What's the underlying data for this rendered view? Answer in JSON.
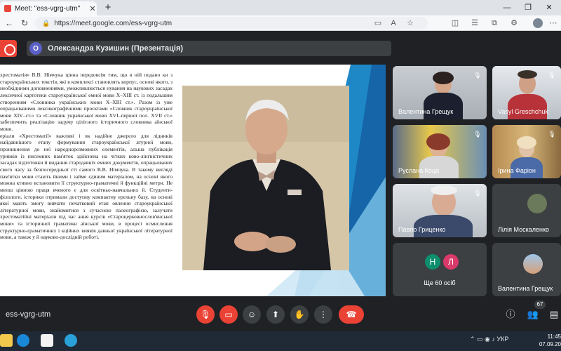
{
  "browser": {
    "tab_title": "Meet: \"ess-vgrg-utm\"",
    "url": "https://meet.google.com/ess-vgrg-utm"
  },
  "meeting": {
    "presenter_initial": "O",
    "presenter_label": "Олександра Кузишин (Презентація)",
    "meeting_code": "ess-vgrg-utm",
    "participant_count": "67"
  },
  "slide": {
    "paragraphs": [
      "хрестоматія» В.В. Німчука цінна передовсім тим, що в ній подано ки з староукраїнських текстів, які в комплексі становлять корпус, основі якого, з необхідними доповненнями, уможливлюється нування на наукових засадах лексичної картотеки староукраїнської емної мови X–XIII ст. із подальшим створенням «Словника українських мови X–XIII ст.». Разом із уже опрацьованими лексикографічними проєктами «Словник староукраїнської мови XIV–ст.» та «Словник української мови XVI–першої пол. XVII ст.» забезпечить реалізацію задуму цілісного історичного словника аїнської мови.",
      "еріали «Хрестоматії» важливі і як надійне джерело для лідників найдавнішого етапу формування староукраїнської атурної мови, проникнення до неї народнорозмовних елементів, альша публікація уривків із писемних пам'яток здійснена на чітких ково-лінгвістичних засадах підготовки й видання стародавніх емних документів, опрацьованих свого часу за безпосередньої сті самого В.В. Німчука. В такому вигляді пам'ятки мови стають йними і займе єдиним матеріалом, на основі якого можна ктивно встановити її структурно-граматичні й функційні метри. Не менш цінною праця вченого є для освітньо-навчальних й. Студенти-філологи, історики отримали доступну компактну ерельну базу, на основі якої мають змогу вивчати початковий етап овлення староукраїнської літературної мови, знайомитися з сучасною палеографією, залучати хрестоматійні матеріали під час ання курсів «Староцерковнослов'янської мови» та історичної граматики аїнської мови, в процесі осмислення структурно-граматичних і кційних виявів давньої української літературної мови, а також у й науково-дослідній роботі."
    ]
  },
  "participants": [
    {
      "name": "Валентина Грещук",
      "muted": true
    },
    {
      "name": "Vasyl Greschchuk",
      "muted": true
    },
    {
      "name": "Руслана Коца",
      "muted": true
    },
    {
      "name": "Ірина Фаріон",
      "muted": true
    },
    {
      "name": "Павло Гриценко",
      "muted": true
    },
    {
      "name": "Лілія Москаленко",
      "muted": false
    },
    {
      "name": "Валентина Грещук",
      "muted": false
    }
  ],
  "others_tile": {
    "avatars": [
      "Н",
      "Л"
    ],
    "label": "Ще 60 осіб"
  },
  "taskbar": {
    "lang": "УКР",
    "time": "11:45",
    "date": "07.09.20"
  },
  "colors": {
    "meet_bg": "#202124",
    "tile_bg": "#3c4043",
    "red": "#ea4335",
    "selected": "#8ab4f8"
  }
}
